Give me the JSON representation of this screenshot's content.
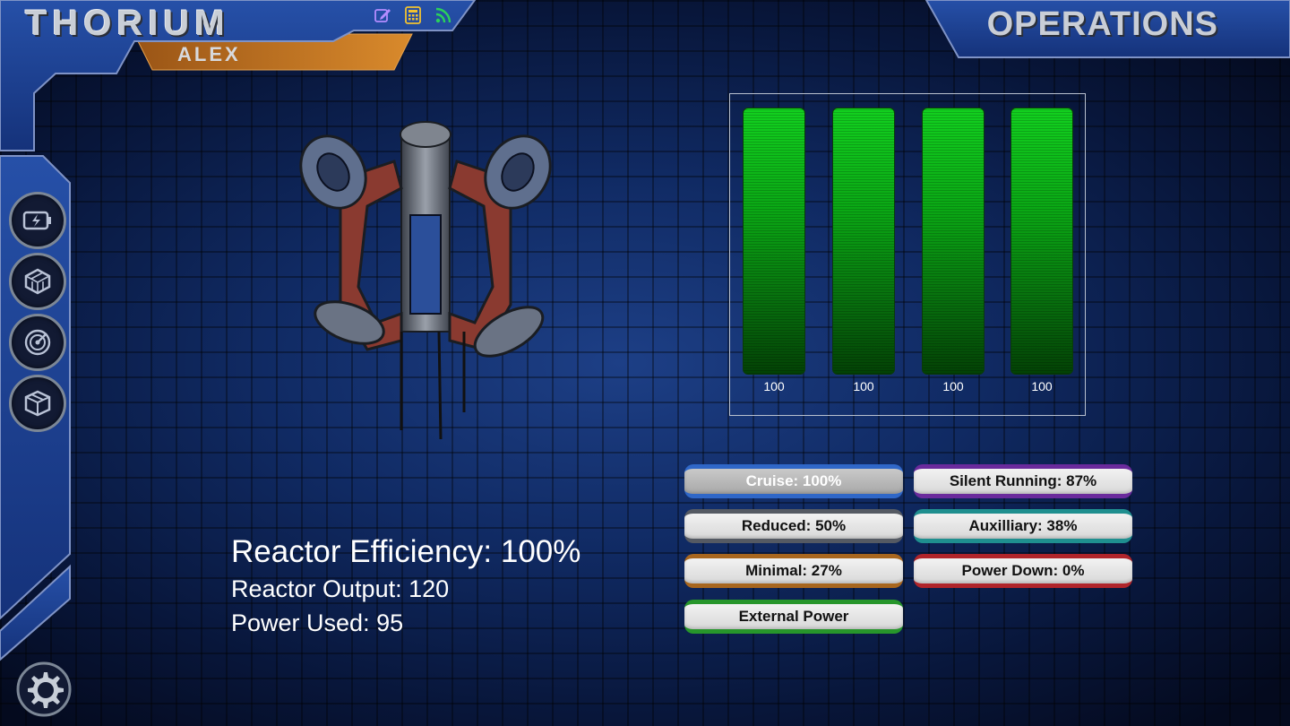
{
  "header": {
    "app_title": "THORIUM",
    "user_name": "ALEX",
    "station_name": "OPERATIONS",
    "top_icons": [
      "edit-icon",
      "calculator-icon",
      "rss-icon"
    ]
  },
  "sidebar": {
    "items": [
      {
        "icon": "battery-charging-icon"
      },
      {
        "icon": "cube-wireframe-icon"
      },
      {
        "icon": "radar-icon"
      },
      {
        "icon": "box-icon"
      }
    ],
    "settings_icon": "gear-icon"
  },
  "reactor": {
    "bars": [
      {
        "value": 100,
        "label": "100"
      },
      {
        "value": 100,
        "label": "100"
      },
      {
        "value": 100,
        "label": "100"
      },
      {
        "value": 100,
        "label": "100"
      }
    ]
  },
  "power_modes": [
    {
      "label": "Cruise: 100%",
      "color": "#2f67c8",
      "active": true
    },
    {
      "label": "Silent Running: 87%",
      "color": "#6a2a9c",
      "active": false
    },
    {
      "label": "Reduced: 50%",
      "color": "#555a63",
      "active": false
    },
    {
      "label": "Auxilliary: 38%",
      "color": "#1f8f8f",
      "active": false
    },
    {
      "label": "Minimal: 27%",
      "color": "#a8661e",
      "active": false
    },
    {
      "label": "Power Down: 0%",
      "color": "#b0242a",
      "active": false
    },
    {
      "label": "External Power",
      "color": "#27962b",
      "active": false
    }
  ],
  "stats": {
    "efficiency": "Reactor Efficiency: 100%",
    "output": "Reactor Output: 120",
    "used": "Power Used: 95"
  },
  "colors": {
    "frame_blue": "#1c3f8f",
    "frame_accent_orange": "#c97a2a",
    "bar_green": "#0fc01a"
  }
}
